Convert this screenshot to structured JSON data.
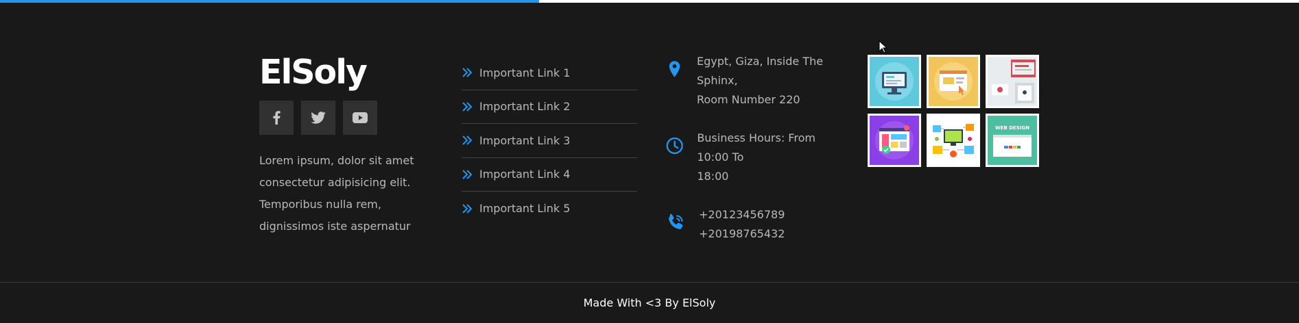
{
  "progress": {
    "fraction": 0.415,
    "fill_color": "#2196f3",
    "track_color": "#ffffff"
  },
  "brand": {
    "logo": "ElSoly",
    "socials": [
      {
        "icon": "facebook-icon"
      },
      {
        "icon": "twitter-icon"
      },
      {
        "icon": "youtube-icon"
      }
    ],
    "about": "Lorem ipsum, dolor sit amet consectetur adipisicing elit. Temporibus nulla rem, dignissimos iste aspernatur"
  },
  "links": [
    {
      "label": "Important Link 1"
    },
    {
      "label": "Important Link 2"
    },
    {
      "label": "Important Link 3"
    },
    {
      "label": "Important Link 4"
    },
    {
      "label": "Important Link 5"
    }
  ],
  "contact": {
    "address": {
      "icon": "location-pin-icon",
      "lines": [
        "Egypt, Giza, Inside The Sphinx,",
        "Room Number 220"
      ]
    },
    "hours": {
      "icon": "clock-icon",
      "lines": [
        "Business Hours: From 10:00 To",
        "18:00"
      ]
    },
    "phones": {
      "icon": "phone-icon",
      "lines": [
        "+20123456789",
        "+20198765432"
      ]
    }
  },
  "gallery": [
    {
      "name": "gallery-image-monitor"
    },
    {
      "name": "gallery-image-browser-window"
    },
    {
      "name": "gallery-image-desk-workspace"
    },
    {
      "name": "gallery-image-web-ui"
    },
    {
      "name": "gallery-image-devices"
    },
    {
      "name": "gallery-image-web-design"
    }
  ],
  "footer": {
    "copyright": "Made With <3 By ElSoly"
  },
  "colors": {
    "background": "#191919",
    "accent": "#2196f3",
    "text": "#b9b9b9",
    "social_bg": "#313131"
  }
}
